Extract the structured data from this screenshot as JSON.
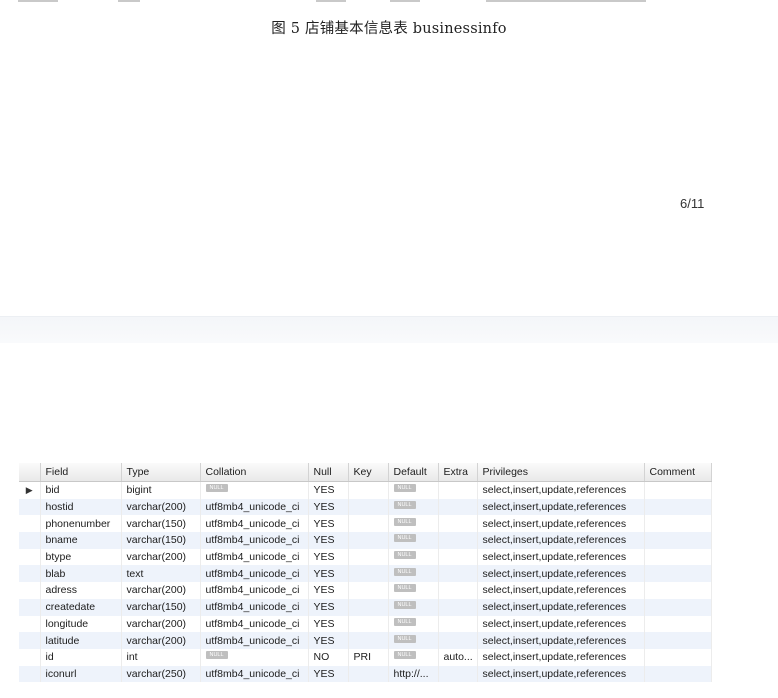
{
  "caption": "图 5 店铺基本信息表 businessinfo",
  "page_number": "6/11",
  "null_label": "NULL",
  "columns": [
    "Field",
    "Type",
    "Collation",
    "Null",
    "Key",
    "Default",
    "Extra",
    "Privileges",
    "Comment"
  ],
  "rows": [
    {
      "field": "bid",
      "type": "bigint",
      "collation": null,
      "null": "YES",
      "key": "",
      "default": null,
      "extra": "",
      "privileges": "select,insert,update,references",
      "comment": "",
      "current": true
    },
    {
      "field": "hostid",
      "type": "varchar(200)",
      "collation": "utf8mb4_unicode_ci",
      "null": "YES",
      "key": "",
      "default": null,
      "extra": "",
      "privileges": "select,insert,update,references",
      "comment": ""
    },
    {
      "field": "phonenumber",
      "type": "varchar(150)",
      "collation": "utf8mb4_unicode_ci",
      "null": "YES",
      "key": "",
      "default": null,
      "extra": "",
      "privileges": "select,insert,update,references",
      "comment": ""
    },
    {
      "field": "bname",
      "type": "varchar(150)",
      "collation": "utf8mb4_unicode_ci",
      "null": "YES",
      "key": "",
      "default": null,
      "extra": "",
      "privileges": "select,insert,update,references",
      "comment": ""
    },
    {
      "field": "btype",
      "type": "varchar(200)",
      "collation": "utf8mb4_unicode_ci",
      "null": "YES",
      "key": "",
      "default": null,
      "extra": "",
      "privileges": "select,insert,update,references",
      "comment": ""
    },
    {
      "field": "blab",
      "type": "text",
      "collation": "utf8mb4_unicode_ci",
      "null": "YES",
      "key": "",
      "default": null,
      "extra": "",
      "privileges": "select,insert,update,references",
      "comment": ""
    },
    {
      "field": "adress",
      "type": "varchar(200)",
      "collation": "utf8mb4_unicode_ci",
      "null": "YES",
      "key": "",
      "default": null,
      "extra": "",
      "privileges": "select,insert,update,references",
      "comment": ""
    },
    {
      "field": "createdate",
      "type": "varchar(150)",
      "collation": "utf8mb4_unicode_ci",
      "null": "YES",
      "key": "",
      "default": null,
      "extra": "",
      "privileges": "select,insert,update,references",
      "comment": ""
    },
    {
      "field": "longitude",
      "type": "varchar(200)",
      "collation": "utf8mb4_unicode_ci",
      "null": "YES",
      "key": "",
      "default": null,
      "extra": "",
      "privileges": "select,insert,update,references",
      "comment": ""
    },
    {
      "field": "latitude",
      "type": "varchar(200)",
      "collation": "utf8mb4_unicode_ci",
      "null": "YES",
      "key": "",
      "default": null,
      "extra": "",
      "privileges": "select,insert,update,references",
      "comment": ""
    },
    {
      "field": "id",
      "type": "int",
      "collation": null,
      "null": "NO",
      "key": "PRI",
      "default": null,
      "extra": "auto...",
      "privileges": "select,insert,update,references",
      "comment": ""
    },
    {
      "field": "iconurl",
      "type": "varchar(250)",
      "collation": "utf8mb4_unicode_ci",
      "null": "YES",
      "key": "",
      "default": "http://...",
      "extra": "",
      "privileges": "select,insert,update,references",
      "comment": ""
    }
  ]
}
